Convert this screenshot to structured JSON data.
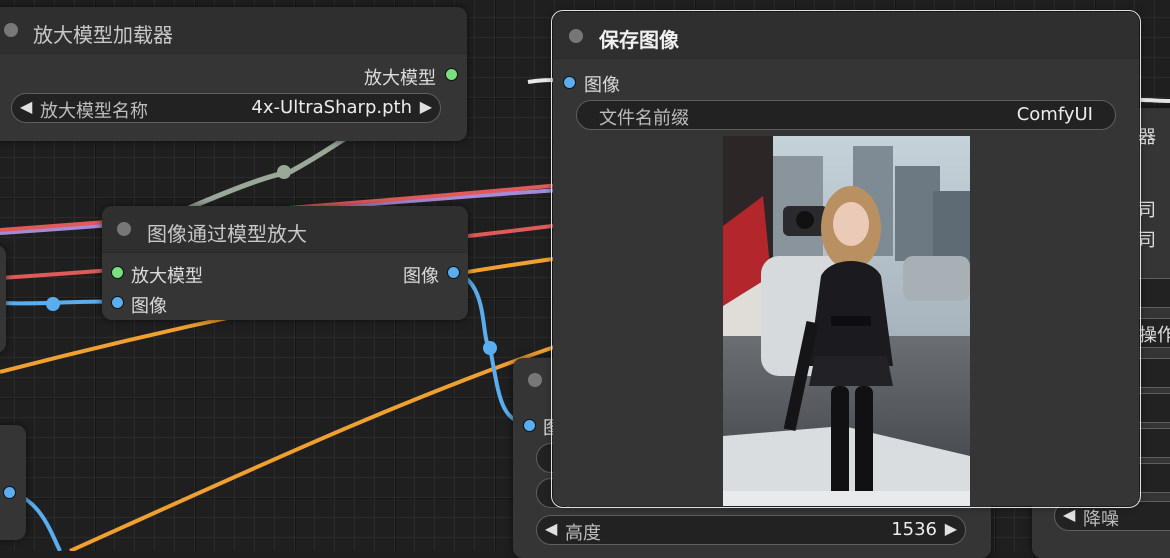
{
  "colors": {
    "link_orange": "#f0a030",
    "link_red": "#e05a5a",
    "link_purple": "#a48ad8",
    "link_blue": "#5aaef0",
    "link_green": "#9aa89a",
    "slot_green": "#78e07c",
    "slot_blue": "#5aaef0"
  },
  "upscale_loader": {
    "title": "放大模型加载器",
    "output_label": "放大模型",
    "widget": {
      "arrow_left": "◀",
      "name": "放大模型名称",
      "value": "4x-UltraSharp.pth",
      "arrow_right": "▶"
    }
  },
  "upscale_with_model": {
    "title": "图像通过模型放大",
    "input_model": "放大模型",
    "input_image": "图像",
    "output_image": "图像"
  },
  "save_image": {
    "title": "保存图像",
    "input_image": "图像",
    "widget": {
      "name": "文件名前缀",
      "value": "ComfyUI"
    },
    "preview": "preview-image"
  },
  "bottom_node": {
    "input_partial": "图",
    "widget_height": {
      "arrow_left": "◀",
      "name": "高度",
      "value": "1536",
      "arrow_right": "▶"
    }
  },
  "right_node": {
    "title_partial": "器",
    "text1": "司",
    "text2": "司",
    "text3": "操作",
    "widget_denoise": {
      "arrow_left": "◀",
      "name": "降噪"
    }
  }
}
